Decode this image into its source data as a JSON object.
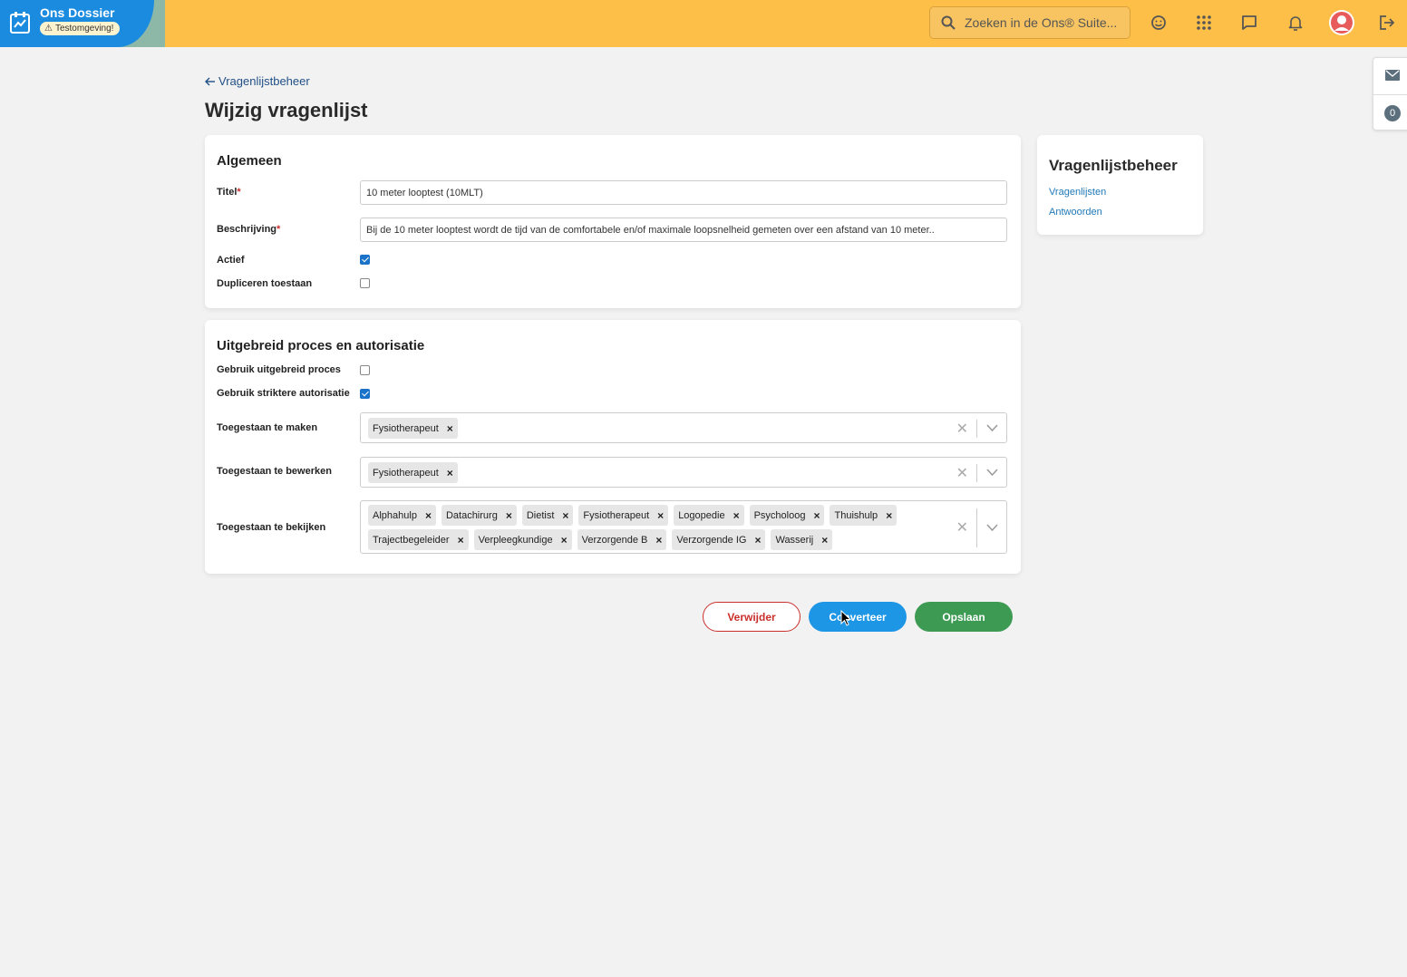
{
  "topbar": {
    "app_title": "Ons Dossier",
    "env_badge": "Testomgeving!",
    "search_placeholder": "Zoeken in de Ons® Suite...",
    "icons": [
      "smiley-refresh-icon",
      "apps-grid-icon",
      "chat-icon",
      "bell-icon",
      "avatar",
      "logout-icon"
    ]
  },
  "side_widget": {
    "count": "0"
  },
  "breadcrumb": {
    "back_label": "Vragenlijstbeheer"
  },
  "page": {
    "title": "Wijzig vragenlijst"
  },
  "general": {
    "title": "Algemeen",
    "titel_label": "Titel",
    "titel_value": "10 meter looptest (10MLT)",
    "beschrijving_label": "Beschrijving",
    "beschrijving_value": "Bij de 10 meter looptest wordt de tijd van de comfortabele en/of maximale loopsnelheid gemeten over een afstand van 10 meter..",
    "actief_label": "Actief",
    "actief_checked": true,
    "dupliceren_label": "Dupliceren toestaan",
    "dupliceren_checked": false
  },
  "process": {
    "title": "Uitgebreid proces en autorisatie",
    "uitgebreid_label": "Gebruik uitgebreid proces",
    "uitgebreid_checked": false,
    "strikt_label": "Gebruik striktere autorisatie",
    "strikt_checked": true,
    "maken_label": "Toegestaan te maken",
    "maken_tags": [
      "Fysiotherapeut"
    ],
    "bewerken_label": "Toegestaan te bewerken",
    "bewerken_tags": [
      "Fysiotherapeut"
    ],
    "bekijken_label": "Toegestaan te bekijken",
    "bekijken_tags": [
      "Alphahulp",
      "Datachirurg",
      "Dietist",
      "Fysiotherapeut",
      "Logopedie",
      "Psycholoog",
      "Thuishulp",
      "Trajectbegeleider",
      "Verpleegkundige",
      "Verzorgende B",
      "Verzorgende IG",
      "Wasserij"
    ]
  },
  "actions": {
    "delete_label": "Verwijder",
    "convert_label": "Converteer",
    "save_label": "Opslaan"
  },
  "side_card": {
    "title": "Vragenlijstbeheer",
    "links": [
      "Vragenlijsten",
      "Antwoorden"
    ]
  },
  "colors": {
    "topbar": "#fdbf47",
    "brand": "#1b8be0",
    "delete": "#c9302c",
    "convert": "#1d96e6",
    "save": "#3c9a52"
  }
}
